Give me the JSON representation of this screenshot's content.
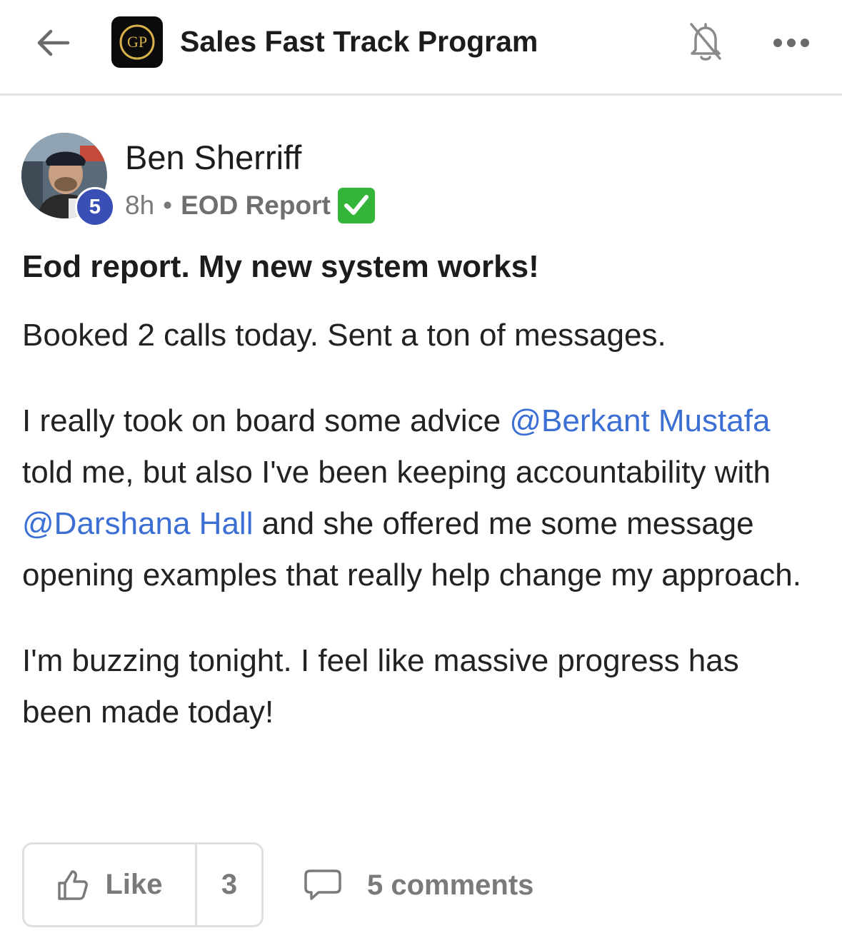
{
  "header": {
    "group_name": "Sales Fast Track Program",
    "logo_text": "GP",
    "icons": {
      "back": "arrow-left-icon",
      "notifications": "bell-icon",
      "more": "more-horizontal-icon"
    }
  },
  "post": {
    "author": {
      "name": "Ben Sherriff",
      "level": "5"
    },
    "time": "8h",
    "separator": "•",
    "category": "EOD Report",
    "category_emoji": "white-check-mark-icon",
    "title": "Eod report. My new system works!",
    "body": {
      "p1": "Booked 2 calls today. Sent a ton of messages.",
      "p2_part1": "I really took on board some advice ",
      "mention1": "@Berkant Mustafa",
      "p2_part2": " told me, but also I've been keeping accountability with ",
      "mention2": "@Darshana Hall",
      "p2_part3": " and she offered me some message opening examples that really help change my approach.",
      "p3": "I'm buzzing tonight. I feel like massive progress has been made today!"
    },
    "actions": {
      "like_label": "Like",
      "like_count": "3",
      "comments_label": "5 comments"
    }
  },
  "colors": {
    "mention": "#3b6fd4",
    "level_badge": "#3a4fb5",
    "check_emoji": "#34b53a",
    "muted_text": "#7a7a7a"
  }
}
